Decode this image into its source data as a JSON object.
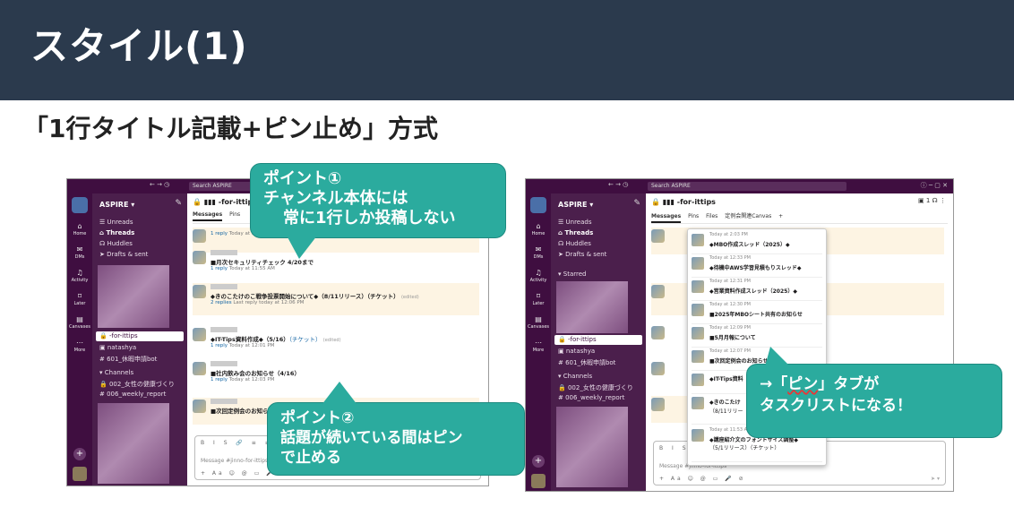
{
  "slide": {
    "title": "スタイル(1)",
    "subtitle": "「1行タイトル記載+ピン止め」方式"
  },
  "shot1": {
    "search": "Search ASPIRE",
    "workspace": "ASPIRE",
    "rail": [
      {
        "icon": "home-icon",
        "label": "Home",
        "glyph": "⌂"
      },
      {
        "icon": "dms-icon",
        "label": "DMs",
        "glyph": "✉"
      },
      {
        "icon": "activity-icon",
        "label": "Activity",
        "glyph": "♫"
      },
      {
        "icon": "later-icon",
        "label": "Later",
        "glyph": "⌑"
      },
      {
        "icon": "canvases-icon",
        "label": "Canvases",
        "glyph": "▤"
      },
      {
        "icon": "more-icon",
        "label": "More",
        "glyph": "⋯"
      }
    ],
    "sidebar": {
      "unreads": "Unreads",
      "threads": "Threads",
      "huddles": "Huddles",
      "drafts": "Drafts & sent",
      "selected_channel": "-for-ittips",
      "dm1": "natashya",
      "ch1": "# 601_休暇申請bot",
      "channels_header": "Channels",
      "ch2": "002_女性の健康づくり",
      "ch3": "# 006_weekly_report"
    },
    "channel": "-for-ittips",
    "tabs": [
      "Messages",
      "Pins"
    ],
    "messages": [
      {
        "text": "",
        "reply": "1 reply",
        "reply_meta": "Today at 11:55 AM"
      },
      {
        "text": "■月次セキュリティチェック 4/20まで",
        "reply": "1 reply",
        "reply_meta": "Today at 11:55 AM"
      },
      {
        "text": "◆きのこたけのこ戦争投票開始について◆（8/11リリース）（チケット）",
        "edited": "(edited)",
        "reply": "2 replies",
        "reply_meta": "Last reply today at 12:06 PM"
      },
      {
        "text": "◆IT-Tips資料作成◆（5/16）",
        "link": "（チケット）",
        "edited": "(edited)",
        "reply": "1 reply",
        "reply_meta": "Today at 12:01 PM"
      },
      {
        "text": "■社内飲み会のお知らせ（4/16）",
        "reply": "1 reply",
        "reply_meta": "Today at 12:03 PM"
      },
      {
        "text": "■次回定例会のお知らせ",
        "reply": "",
        "reply_meta": ""
      }
    ],
    "composer": {
      "toolbar": "B I S 🔗 ≡ ≡ ≡",
      "placeholder": "Message #jinno-for-ittips",
      "bottom": "+ Aa ☺ @ ▭ 🎤 ⊘"
    }
  },
  "shot2": {
    "search": "Search ASPIRE",
    "workspace": "ASPIRE",
    "channel": "-for-ittips",
    "tabs": [
      "Messages",
      "Pins",
      "Files",
      "定例会関連Canvas",
      "+"
    ],
    "member_count": "1",
    "sidebar": {
      "unreads": "Unreads",
      "threads": "Threads",
      "huddles": "Huddles",
      "drafts": "Drafts & sent",
      "starred": "Starred",
      "selected_channel": "-for-ittips",
      "dm1": "natashya",
      "ch1": "# 601_休暇申請bot",
      "channels_header": "Channels",
      "ch2": "002_女性の健康づくり",
      "ch3": "# 006_weekly_report"
    },
    "pins": [
      {
        "time": "Today at 2:03 PM",
        "text": "◆MBO作成スレッド（2025）◆"
      },
      {
        "time": "Today at 12:33 PM",
        "text": "◆待機中AWS学習見積もりスレッド◆"
      },
      {
        "time": "Today at 12:31 PM",
        "text": "◆営業資料作成スレッド（2025）◆"
      },
      {
        "time": "Today at 12:30 PM",
        "text": "■2025年MBOシート共有のお知らせ"
      },
      {
        "time": "Today at 12:09 PM",
        "text": "■5月月報について"
      },
      {
        "time": "Today at 12:07 PM",
        "text": "■次回定例会のお知らせ（5/1"
      },
      {
        "time": "",
        "text": "◆IT-Tips資料"
      },
      {
        "time": "",
        "text": "◆きのこたけ"
      },
      {
        "time": "Today at 11:53 AM",
        "text": "◆講座紹介文のフォントサイズ調整◆"
      }
    ],
    "pin_extra": [
      "（8/11リリー",
      "（5/1リリース）（チケット）"
    ],
    "composer": {
      "toolbar": "B I S 🔗 ≡ ≡ ≡",
      "placeholder": "Message #jinno-for-ittips",
      "bottom": "+ Aa ☺ @ ▭ 🎤 ⊘"
    }
  },
  "callouts": {
    "c1_line1": "ポイント①",
    "c1_line2": "チャンネル本体には",
    "c1_line3": "常に1行しか投稿しない",
    "c2_line1": "ポイント②",
    "c2_line2": "話題が続いている間はピン",
    "c2_line3": "で止める",
    "c3_line1_a": "→「",
    "c3_line1_b": "ピン",
    "c3_line1_c": "」タブが",
    "c3_line2": "タスクリストになる！"
  },
  "colors": {
    "banner": "#2b3a4d",
    "callout": "#2bab9e",
    "slack_sidebar": "#4b1f4c",
    "slack_rail": "#3f0e40"
  }
}
